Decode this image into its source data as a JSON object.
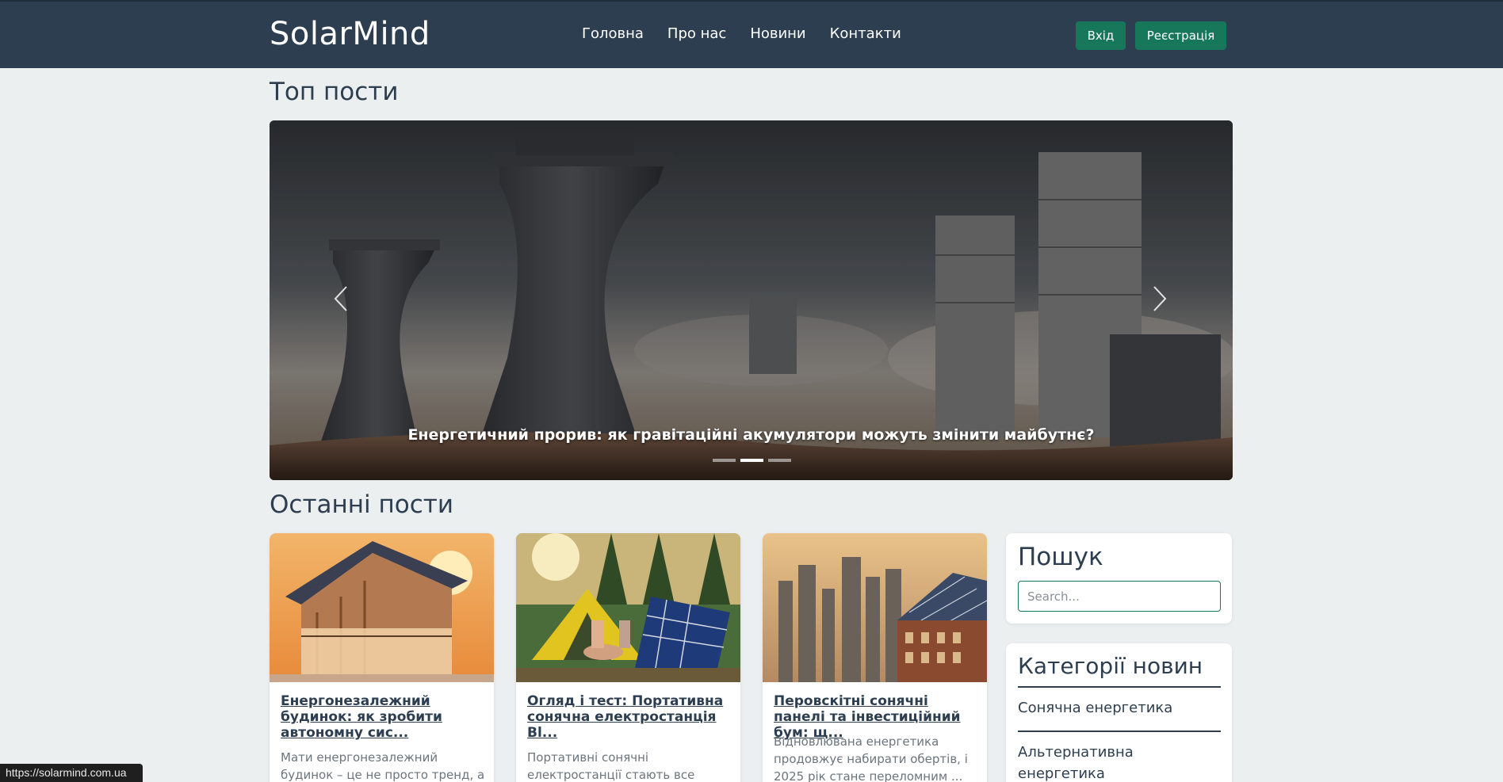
{
  "header": {
    "brand": "SolarMind",
    "nav": [
      "Головна",
      "Про нас",
      "Новини",
      "Контакти"
    ],
    "login": "Вхід",
    "register": "Реєстрація"
  },
  "top_posts": {
    "title": "Топ пости",
    "caption": "Енергетичний прорив: як гравітаційні акумулятори можуть змінити майбутнє?",
    "active_slide": 2,
    "slides": 3
  },
  "latest_posts": {
    "title": "Останні пости",
    "cards": [
      {
        "title": "Енергонезалежний будинок: як зробити автономну сис...",
        "text": " Мати енергонезалежний будинок – це не просто тренд, а"
      },
      {
        "title": "Огляд і тест: Портативна сонячна електростанція Bl...",
        "text": "Портативні сонячні електростанції стають все більш"
      },
      {
        "title": "Перовскітні сонячні панелі та інвестиційний бум: щ...",
        "text": "Відновлювана енергетика продовжує набирати обертів, і 2025 рік стане переломним ..."
      }
    ]
  },
  "sidebar": {
    "search_title": "Пошук",
    "search_placeholder": "Search...",
    "categories_title": "Категорії новин",
    "categories": [
      "Сонячна енергетика",
      "Альтернативна енергетика"
    ]
  },
  "status_bar": {
    "url": "https://solarmind.com.ua"
  },
  "colors": {
    "navbar": "#2d3e50",
    "accent": "#17775a",
    "background": "#ebeff0"
  }
}
